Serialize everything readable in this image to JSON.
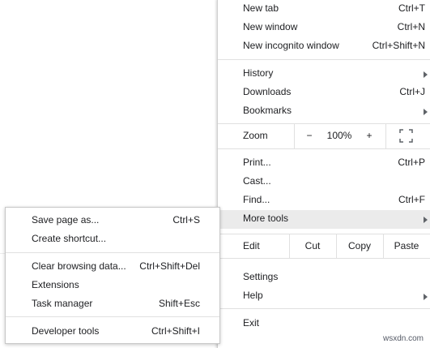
{
  "menu": {
    "new_tab": {
      "label": "New tab",
      "shortcut": "Ctrl+T"
    },
    "new_window": {
      "label": "New window",
      "shortcut": "Ctrl+N"
    },
    "new_incognito": {
      "label": "New incognito window",
      "shortcut": "Ctrl+Shift+N"
    },
    "history": {
      "label": "History"
    },
    "downloads": {
      "label": "Downloads",
      "shortcut": "Ctrl+J"
    },
    "bookmarks": {
      "label": "Bookmarks"
    },
    "zoom": {
      "label": "Zoom",
      "minus": "−",
      "value": "100%",
      "plus": "+"
    },
    "print": {
      "label": "Print...",
      "shortcut": "Ctrl+P"
    },
    "cast": {
      "label": "Cast..."
    },
    "find": {
      "label": "Find...",
      "shortcut": "Ctrl+F"
    },
    "more_tools": {
      "label": "More tools"
    },
    "edit": {
      "label": "Edit",
      "cut": "Cut",
      "copy": "Copy",
      "paste": "Paste"
    },
    "settings": {
      "label": "Settings"
    },
    "help": {
      "label": "Help"
    },
    "exit": {
      "label": "Exit"
    }
  },
  "more_tools_submenu": {
    "save_page": {
      "label": "Save page as...",
      "shortcut": "Ctrl+S"
    },
    "create_shortcut": {
      "label": "Create shortcut..."
    },
    "clear_browsing": {
      "label": "Clear browsing data...",
      "shortcut": "Ctrl+Shift+Del"
    },
    "extensions": {
      "label": "Extensions"
    },
    "task_manager": {
      "label": "Task manager",
      "shortcut": "Shift+Esc"
    },
    "developer_tools": {
      "label": "Developer tools",
      "shortcut": "Ctrl+Shift+I"
    }
  },
  "watermark": "wsxdn.com",
  "colors": {
    "highlight": "#ebebeb",
    "text": "#202124",
    "separator": "#e0e0e0"
  }
}
